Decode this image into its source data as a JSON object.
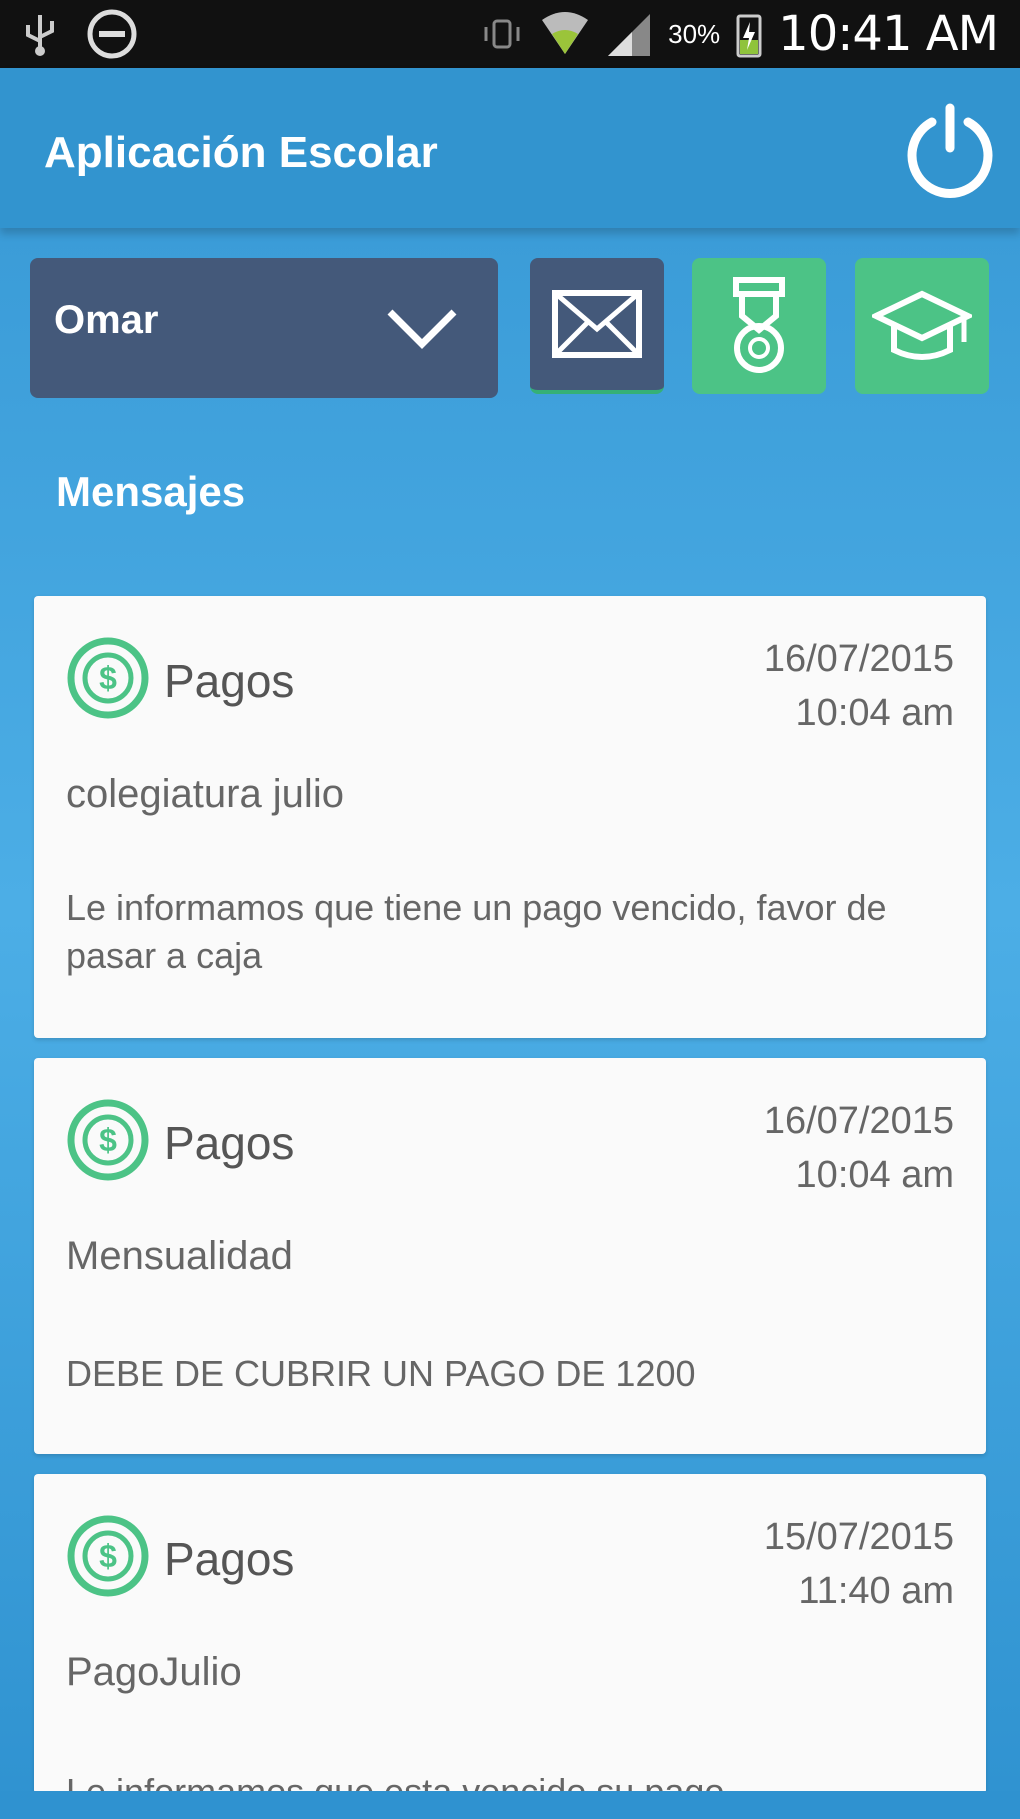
{
  "status_bar": {
    "battery": "30%",
    "time": "10:41 AM"
  },
  "app_bar": {
    "title": "Aplicación Escolar"
  },
  "toolbar": {
    "selected_student": "Omar"
  },
  "section": {
    "title": "Mensajes"
  },
  "messages": [
    {
      "category": "Pagos",
      "date": "16/07/2015",
      "time": "10:04 am",
      "subject": "colegiatura julio",
      "body": "Le informamos que tiene un pago vencido, favor de pasar a caja"
    },
    {
      "category": "Pagos",
      "date": "16/07/2015",
      "time": "10:04 am",
      "subject": "Mensualidad",
      "body": "DEBE DE CUBRIR UN PAGO DE 1200"
    },
    {
      "category": "Pagos",
      "date": "15/07/2015",
      "time": "11:40 am",
      "subject": "PagoJulio",
      "body": "Le informamos que esta vencido su pago"
    }
  ],
  "colors": {
    "primary": "#3294cf",
    "dark_tile": "#44597a",
    "green": "#4cc386",
    "card": "#fafafa"
  }
}
